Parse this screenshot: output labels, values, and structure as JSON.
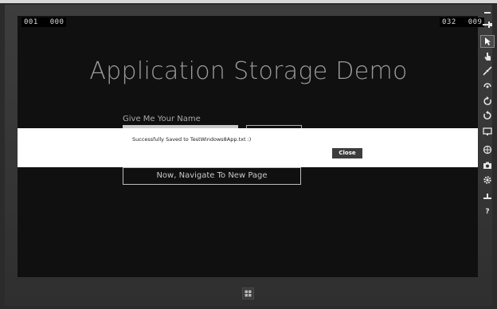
{
  "app": {
    "title": "Application Storage Demo",
    "name_label": "Give Me Your Name",
    "name_value": "",
    "navigate_label": "Now, Navigate To New Page"
  },
  "counters": {
    "left": [
      "001",
      "000"
    ],
    "right": [
      "032",
      "009"
    ]
  },
  "dialog": {
    "message": "Successfully Saved to TestWindows8App.txt :)",
    "close_label": "Close"
  },
  "simulator_toolbar": {
    "items": [
      {
        "icon": "minimize-icon"
      },
      {
        "icon": "pin-icon"
      },
      {
        "icon": "mouse-mode-icon",
        "active": true
      },
      {
        "icon": "touch-mode-icon"
      },
      {
        "icon": "pinch-zoom-icon"
      },
      {
        "icon": "rotate-touch-icon"
      },
      {
        "icon": "rotate-clockwise-icon"
      },
      {
        "icon": "rotate-counterclockwise-icon"
      },
      {
        "icon": "change-resolution-icon"
      },
      {
        "icon": "set-location-icon"
      },
      {
        "icon": "screenshot-icon"
      },
      {
        "icon": "settings-icon"
      },
      {
        "icon": "network-icon"
      },
      {
        "icon": "help-icon"
      }
    ]
  },
  "colors": {
    "screen_bg": "#101010",
    "dialog_bg": "#ffffff",
    "close_button": "#3d3d3d",
    "title_text": "#9c9c9c"
  }
}
